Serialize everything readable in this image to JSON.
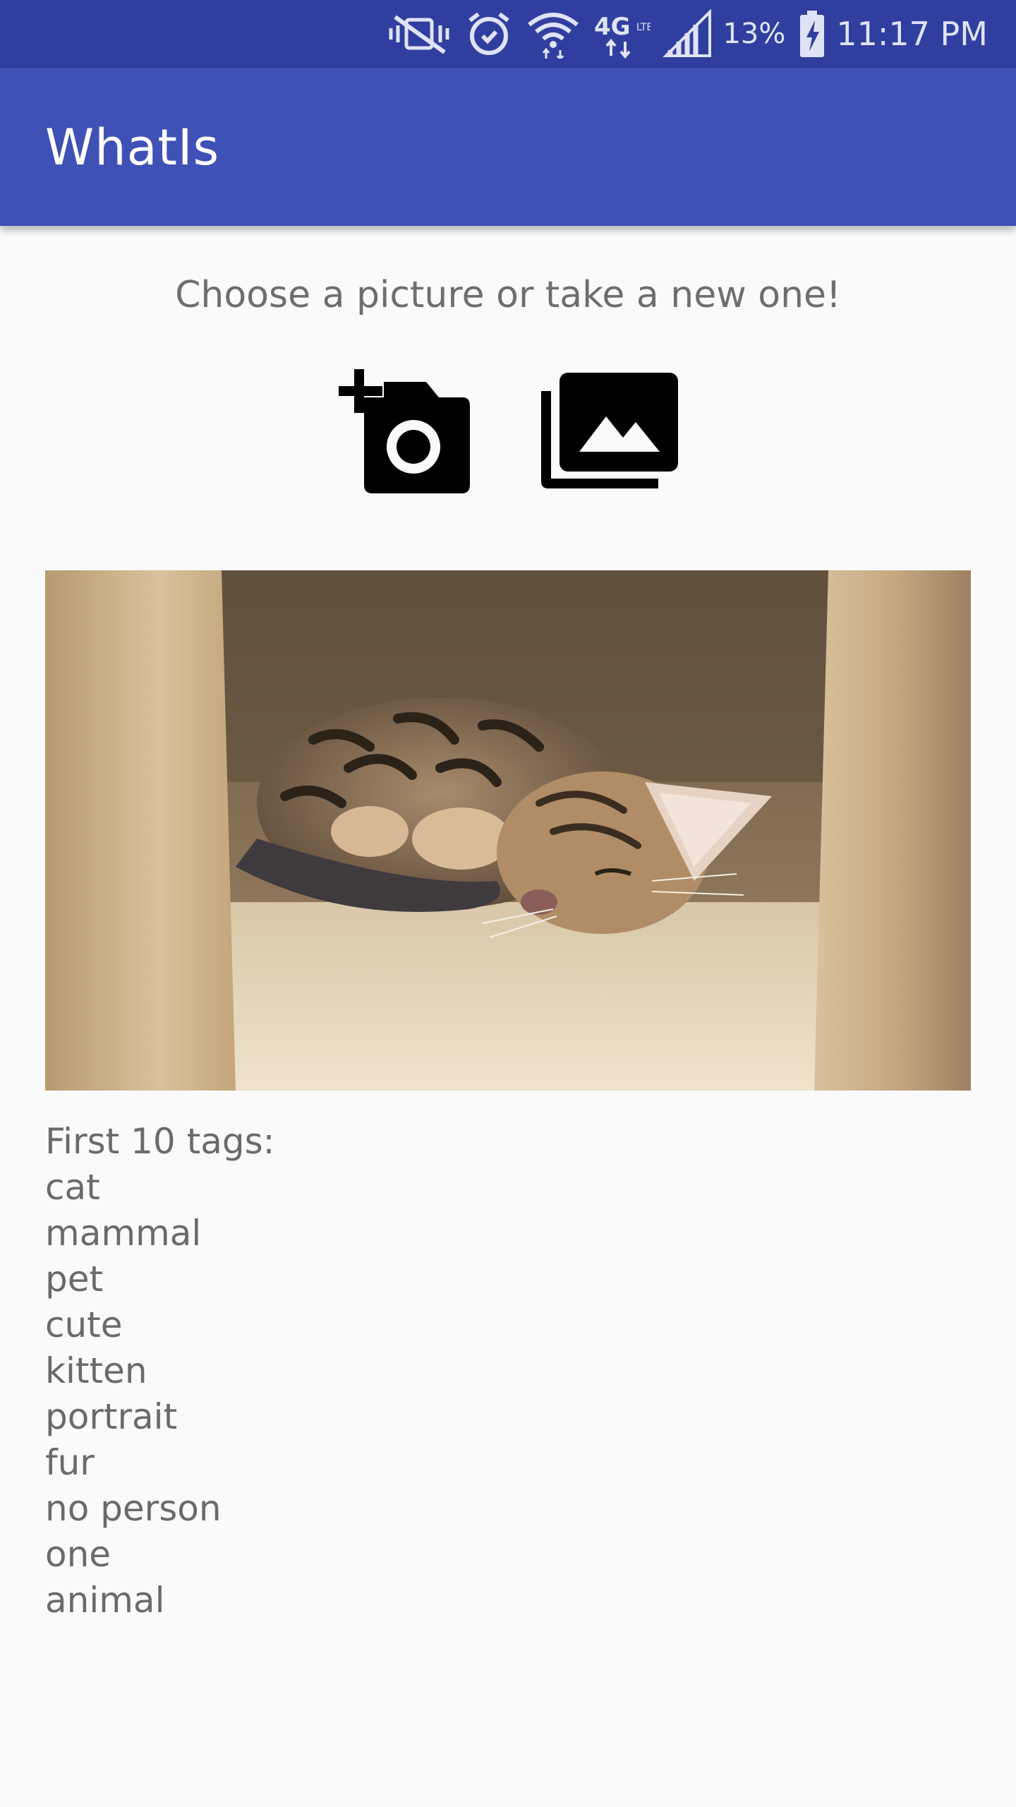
{
  "status_bar": {
    "battery": "13%",
    "time": "11:17 PM",
    "network": "4G",
    "network_sub": "LTE",
    "icons": [
      "vibrate-mute-icon",
      "alarm-icon",
      "wifi-icon",
      "lte-icon",
      "signal-icon",
      "battery-charging-icon"
    ]
  },
  "app_bar": {
    "title": "WhatIs"
  },
  "main": {
    "prompt": "Choose a picture or take a new one!",
    "actions": [
      {
        "name": "take-photo-button",
        "icon": "add-camera-icon"
      },
      {
        "name": "choose-picture-button",
        "icon": "photo-library-icon"
      }
    ],
    "image": {
      "subject": "photo-image"
    },
    "tags_heading": "First 10 tags:",
    "tags": [
      "cat",
      "mammal",
      "pet",
      "cute",
      "kitten",
      "portrait",
      "fur",
      "no person",
      "one",
      "animal"
    ]
  },
  "colors": {
    "status_bar": "#303f9f",
    "app_bar": "#3f51b5",
    "background": "#fafafa",
    "text": "#6e6e6e"
  }
}
